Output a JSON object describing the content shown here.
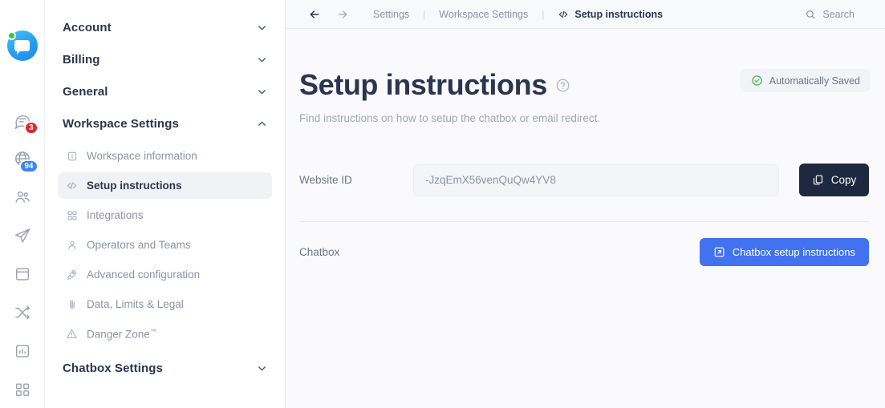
{
  "rail": {
    "logo_name": "crisp-logo",
    "status": "online",
    "items": [
      {
        "icon": "chat-bubble-icon",
        "name": "inbox",
        "badge": "3",
        "badge_color": "#e0252a"
      },
      {
        "icon": "globe-icon",
        "name": "visitors",
        "badge": "94",
        "badge_color": "#3b86f0"
      },
      {
        "icon": "contacts-icon",
        "name": "contacts",
        "badge": null
      },
      {
        "icon": "paper-plane-icon",
        "name": "campaigns",
        "badge": null
      },
      {
        "icon": "box-icon",
        "name": "helpdesk",
        "badge": null
      },
      {
        "icon": "shuffle-icon",
        "name": "routing",
        "badge": null
      },
      {
        "icon": "chart-icon",
        "name": "analytics",
        "badge": null
      },
      {
        "icon": "grid-icon",
        "name": "plugins",
        "badge": null
      }
    ]
  },
  "nav": {
    "groups": [
      {
        "label": "Account",
        "expanded": false,
        "chevron": "chevron-down-icon"
      },
      {
        "label": "Billing",
        "expanded": false,
        "chevron": "chevron-down-icon"
      },
      {
        "label": "General",
        "expanded": false,
        "chevron": "chevron-down-icon"
      },
      {
        "label": "Workspace Settings",
        "expanded": true,
        "chevron": "chevron-up-icon"
      }
    ],
    "workspace_items": [
      {
        "label": "Workspace information",
        "icon": "info-icon",
        "active": false
      },
      {
        "label": "Setup instructions",
        "icon": "code-icon",
        "active": true
      },
      {
        "label": "Integrations",
        "icon": "grid-icon",
        "active": false
      },
      {
        "label": "Operators and Teams",
        "icon": "person-icon",
        "active": false
      },
      {
        "label": "Advanced configuration",
        "icon": "rocket-icon",
        "active": false
      },
      {
        "label": "Data, Limits & Legal",
        "icon": "paperclip-icon",
        "active": false
      },
      {
        "label": "Danger Zone",
        "suffix": "™",
        "icon": "warning-triangle-icon",
        "active": false
      }
    ],
    "last_group": {
      "label": "Chatbox Settings",
      "chevron": "chevron-down-icon"
    }
  },
  "topbar": {
    "back_icon": "arrow-left-icon",
    "forward_icon": "arrow-right-icon",
    "breadcrumbs": [
      {
        "label": "Settings",
        "current": false
      },
      {
        "label": "Workspace Settings",
        "current": false
      },
      {
        "label": "Setup instructions",
        "current": true,
        "icon": "code-icon"
      }
    ],
    "separator": "|",
    "search_label": "Search",
    "search_icon": "search-icon"
  },
  "page": {
    "title": "Setup instructions",
    "help_icon": "question-circle-icon",
    "subtitle": "Find instructions on how to setup the chatbox or email redirect.",
    "saved_badge": {
      "label": "Automatically Saved",
      "icon": "check-circle-icon",
      "color": "#4caf50"
    }
  },
  "form": {
    "website_id_label": "Website ID",
    "website_id_value": "-JzqEmX56venQuQw4YV8",
    "copy_label": "Copy",
    "copy_icon": "copy-icon",
    "chatbox_label": "Chatbox",
    "chatbox_button_label": "Chatbox setup instructions",
    "chatbox_button_icon": "external-link-icon",
    "accent_color": "#4272f0",
    "dark_color": "#1e2940"
  }
}
